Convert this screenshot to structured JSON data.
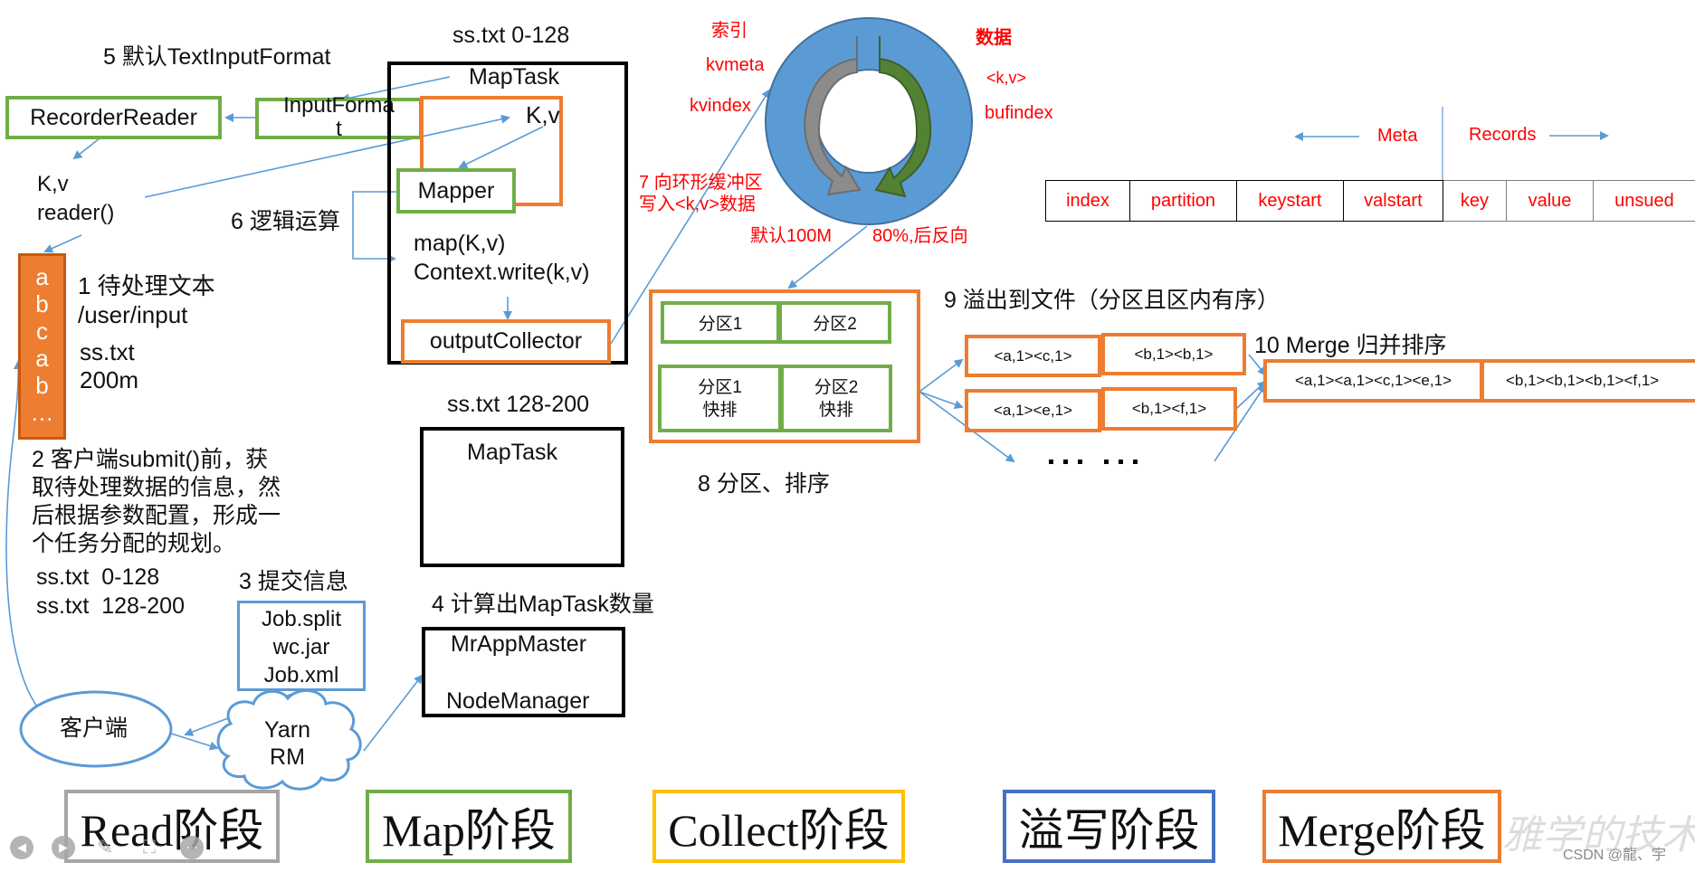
{
  "read": {
    "step5_label": "5 默认TextInputFormat",
    "recorder_reader": "RecorderReader",
    "input_format_line1": "InputForma",
    "input_format_line2": "t",
    "kv": "K,v",
    "reader_call": "reader()",
    "file_letters": [
      "a",
      "b",
      "c",
      "a",
      "b",
      "…"
    ],
    "step1_label": "1 待处理文本",
    "input_path": "/user/input",
    "file_name": "ss.txt",
    "file_size": "200m",
    "step2_lines": [
      "2 客户端submit()前，获",
      "取待处理数据的信息，然",
      "后根据参数配置，形成一",
      "个任务分配的规划。"
    ],
    "splits": [
      "ss.txt  0-128",
      "ss.txt  128-200"
    ],
    "step3_label": "3 提交信息",
    "job_files": [
      "Job.split",
      "wc.jar",
      "Job.xml"
    ],
    "client": "客户端",
    "yarn_line1": "Yarn",
    "yarn_line2": "RM"
  },
  "map": {
    "split1_label": "ss.txt 0-128",
    "maptask1_title": "MapTask",
    "kv": "K,v",
    "mapper": "Mapper",
    "step6_label": "6 逻辑运算",
    "map_call": "map(K,v)",
    "context_write": "Context.write(k,v)",
    "output_collector": "outputCollector",
    "split2_label": "ss.txt 128-200",
    "maptask2_title": "MapTask",
    "step4_label": "4 计算出MapTask数量",
    "mrappmaster": "MrAppMaster",
    "nodemanager": "NodeManager"
  },
  "collect": {
    "index_label": "索引",
    "kvmeta": "kvmeta",
    "kvindex": "kvindex",
    "data_label": "数据",
    "kv_pair": "<k,v>",
    "bufindex": "bufindex",
    "step7_line1": "7 向环形缓冲区",
    "step7_line2": "写入<k,v>数据",
    "default_size": "默认100M",
    "threshold": "80%,后反向",
    "meta_label": "Meta",
    "records_label": "Records",
    "buffer_columns": [
      "index",
      "partition",
      "keystart",
      "valstart",
      "key",
      "value",
      "unsued"
    ]
  },
  "spill": {
    "partitions_top": [
      "分区1",
      "分区2"
    ],
    "partitions_sorted": [
      [
        "分区1",
        "快排"
      ],
      [
        "分区2",
        "快排"
      ]
    ],
    "step8_label": "8 分区、排序",
    "step9_label": "9 溢出到文件（分区且区内有序）",
    "spill_files": [
      [
        "<a,1><c,1>",
        "<b,1><b,1>"
      ],
      [
        "<a,1><e,1>",
        "<b,1><f,1>"
      ]
    ],
    "ellipsis": "… …"
  },
  "merge": {
    "step10_label": "10 Merge 归并排序",
    "merged": [
      "<a,1><a,1><c,1><e,1>",
      "<b,1><b,1><b,1><f,1>"
    ]
  },
  "stages": [
    {
      "label": "Read阶段",
      "color": "#A5A5A5"
    },
    {
      "label": "Map阶段",
      "color": "#70AD47"
    },
    {
      "label": "Collect阶段",
      "color": "#FFC000"
    },
    {
      "label": "溢写阶段",
      "color": "#4472C4"
    },
    {
      "label": "Merge阶段",
      "color": "#ED7D31"
    }
  ],
  "watermark": "雅学的技术",
  "credit": "CSDN @龍、宇",
  "controls": [
    "prev-icon",
    "next-icon",
    "pen-icon",
    "focus-icon",
    "more-icon"
  ]
}
